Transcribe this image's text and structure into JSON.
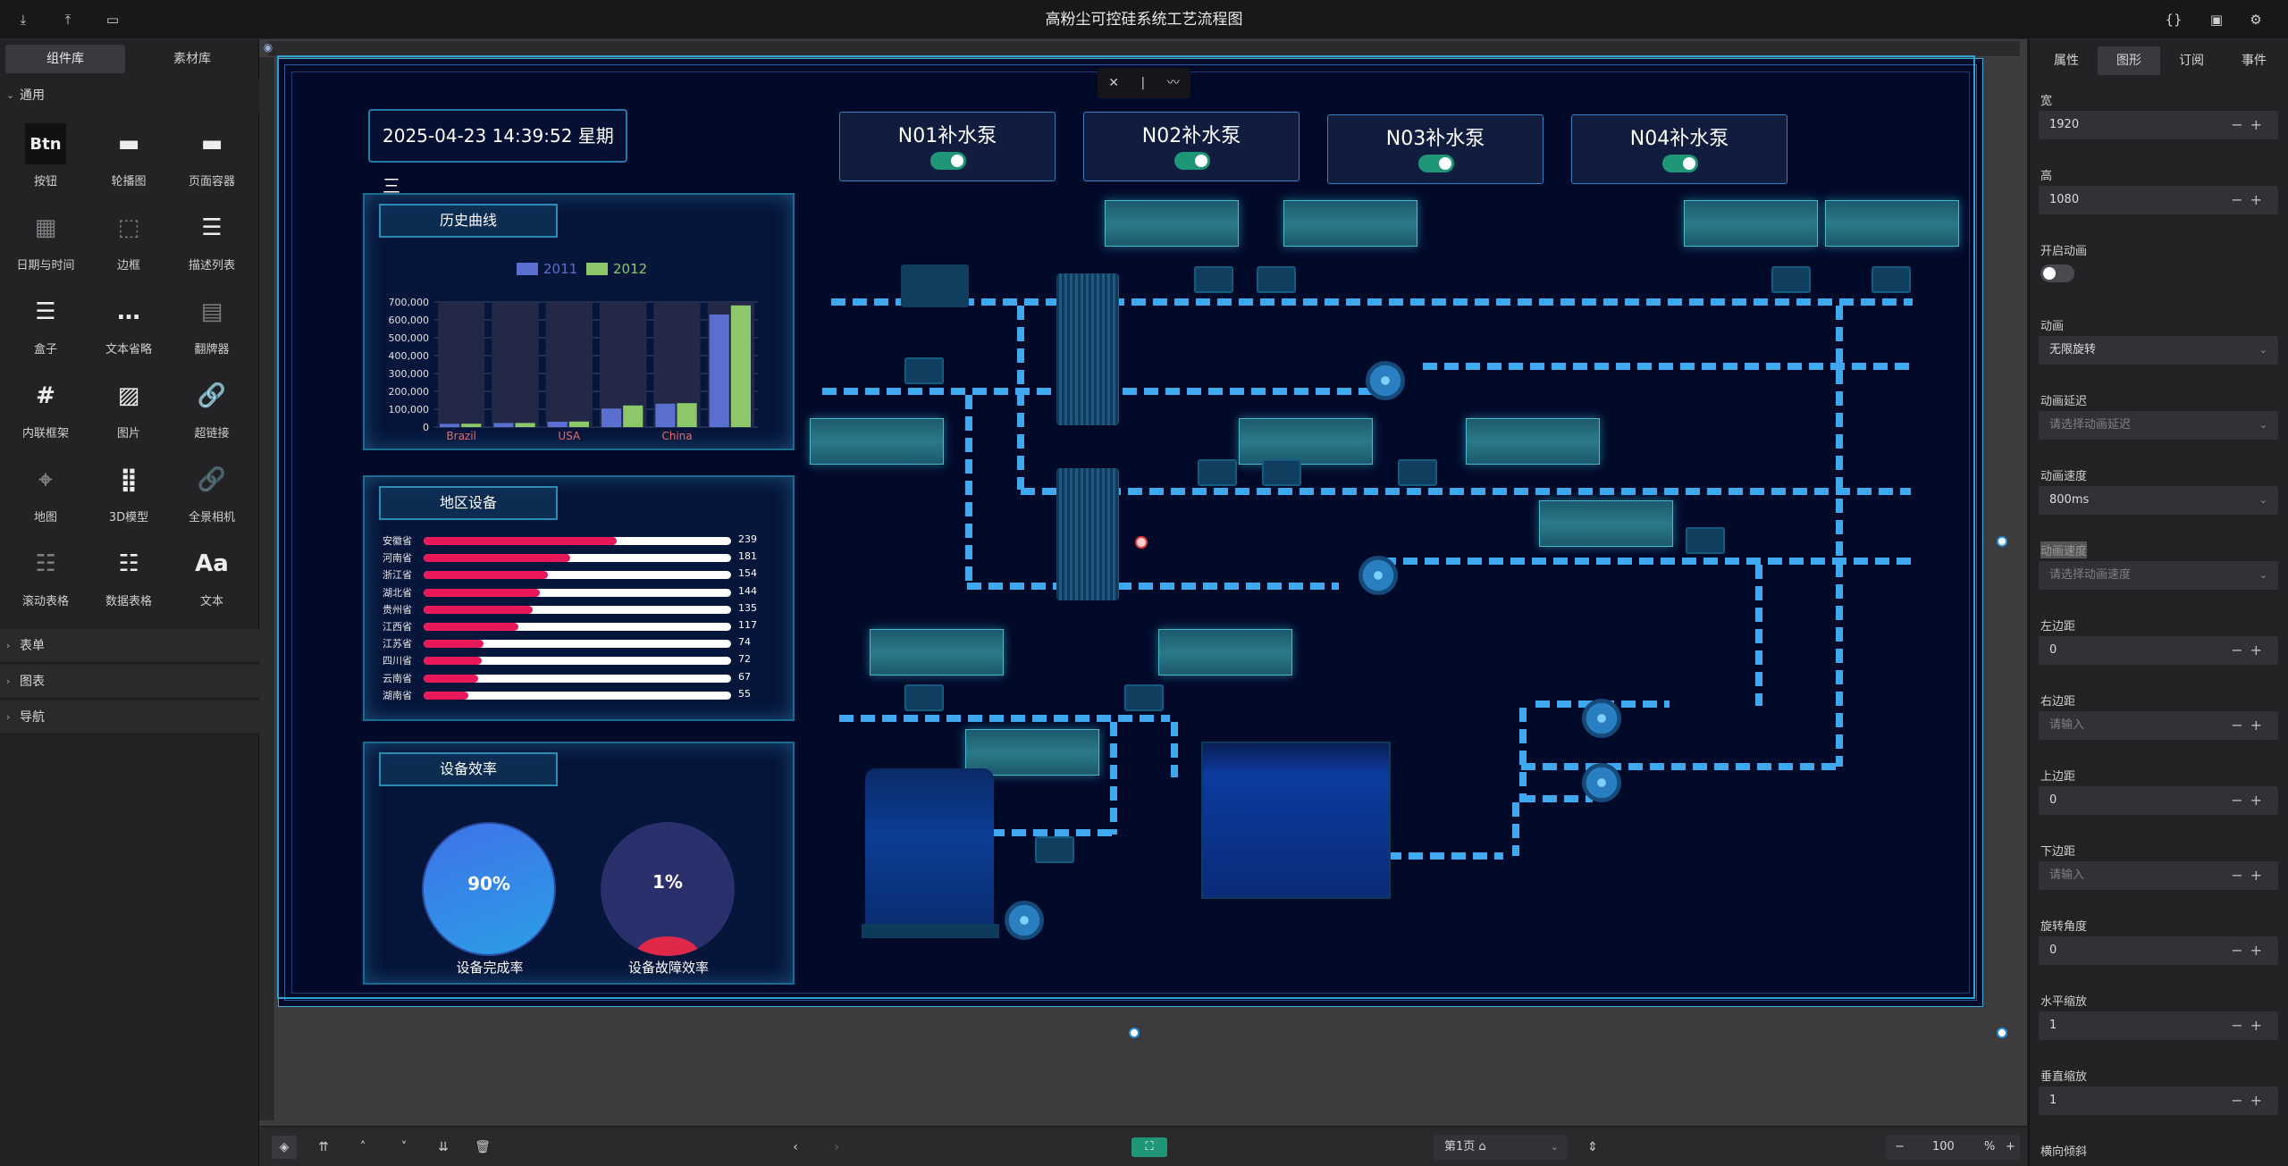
{
  "app": {
    "title": "高粉尘可控硅系统工艺流程图"
  },
  "left_panel": {
    "tabs": [
      "组件库",
      "素材库"
    ],
    "group_general": "通用",
    "components": [
      "按钮",
      "轮播图",
      "页面容器",
      "日期与时间",
      "边框",
      "描述列表",
      "盒子",
      "文本省略",
      "翻牌器",
      "内联框架",
      "图片",
      "超链接",
      "地图",
      "3D模型",
      "全景相机",
      "滚动表格",
      "数据表格",
      "文本"
    ],
    "groups": [
      "表单",
      "图表",
      "导航"
    ]
  },
  "right_panel": {
    "tabs": [
      "属性",
      "图形",
      "订阅",
      "事件"
    ],
    "active_tab": "图形",
    "fields": [
      {
        "label": "宽",
        "value": "1920",
        "kind": "number"
      },
      {
        "label": "高",
        "value": "1080",
        "kind": "number"
      },
      {
        "label": "开启动画",
        "value": "",
        "kind": "switch"
      },
      {
        "label": "动画",
        "value": "无限旋转",
        "kind": "select"
      },
      {
        "label": "动画延迟",
        "value": "请选择动画延迟",
        "kind": "select-ph"
      },
      {
        "label": "动画速度",
        "value": "800ms",
        "kind": "select"
      },
      {
        "label": "动画速度",
        "value": "请选择动画速度",
        "kind": "select-ph"
      },
      {
        "label": "左边距",
        "value": "0",
        "kind": "number"
      },
      {
        "label": "右边距",
        "value": "请输入",
        "kind": "number-ph"
      },
      {
        "label": "上边距",
        "value": "0",
        "kind": "number"
      },
      {
        "label": "下边距",
        "value": "请输入",
        "kind": "number-ph"
      },
      {
        "label": "旋转角度",
        "value": "0",
        "kind": "number"
      },
      {
        "label": "水平缩放",
        "value": "1",
        "kind": "number"
      },
      {
        "label": "垂直缩放",
        "value": "1",
        "kind": "number"
      },
      {
        "label": "横向倾斜",
        "value": "",
        "kind": "label"
      }
    ]
  },
  "bottom_bar": {
    "page_label": "第1页",
    "zoom": "100",
    "zoom_unit": "%"
  },
  "stage": {
    "datetime": "2025-04-23 14:39:52 星期三",
    "pumps": [
      "N01补水泵",
      "N02补水泵",
      "N03补水泵",
      "N04补水泵"
    ],
    "history_card_title": "历史曲线",
    "region_card_title": "地区设备",
    "efficiency_card_title": "设备效率",
    "gauges": [
      {
        "label": "设备完成率",
        "value": "90%"
      },
      {
        "label": "设备故障效率",
        "value": "1%"
      }
    ]
  },
  "chart_data": [
    {
      "type": "bar",
      "title": "",
      "categories": [
        "Brazil",
        "",
        "USA",
        "",
        "China",
        ""
      ],
      "series": [
        {
          "name": "2011",
          "color": "#5b6fd0",
          "values": [
            18000,
            23000,
            30000,
            104000,
            131000,
            630000
          ]
        },
        {
          "name": "2012",
          "color": "#8cc86a",
          "values": [
            19000,
            23000,
            31000,
            121000,
            134000,
            681000
          ]
        }
      ],
      "yticks": [
        "700,000",
        "600,000",
        "500,000",
        "400,000",
        "300,000",
        "200,000",
        "100,000",
        "0"
      ],
      "ylim": [
        0,
        700000
      ],
      "legend_position": "top"
    },
    {
      "type": "bar",
      "orientation": "horizontal",
      "categories": [
        "安徽省",
        "河南省",
        "浙江省",
        "湖北省",
        "贵州省",
        "江西省",
        "江苏省",
        "四川省",
        "云南省",
        "湖南省"
      ],
      "values": [
        239,
        181,
        154,
        144,
        135,
        117,
        74,
        72,
        67,
        55
      ],
      "xlim": [
        0,
        380
      ]
    }
  ]
}
